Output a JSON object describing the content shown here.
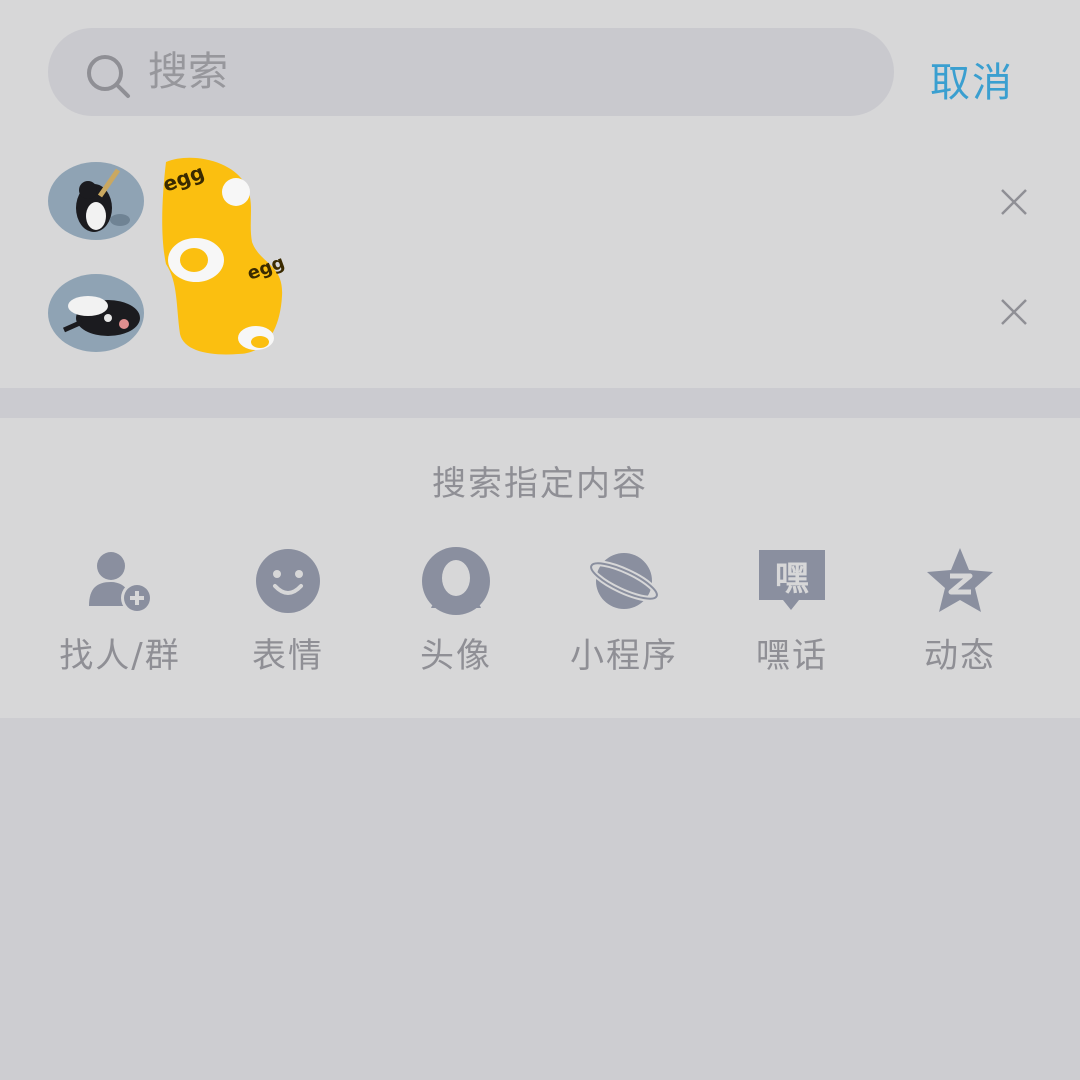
{
  "search": {
    "placeholder": "搜索",
    "cancel_label": "取消"
  },
  "history": [
    {
      "name": "",
      "icon": "penguin-avatar-1"
    },
    {
      "name": "",
      "icon": "penguin-avatar-2"
    }
  ],
  "specified_search": {
    "title": "搜索指定内容",
    "categories": [
      {
        "label": "找人/群",
        "icon": "add-person-icon"
      },
      {
        "label": "表情",
        "icon": "smiley-icon"
      },
      {
        "label": "头像",
        "icon": "avatar-icon"
      },
      {
        "label": "小程序",
        "icon": "planet-icon"
      },
      {
        "label": "嘿话",
        "icon": "speech-bubble-icon"
      },
      {
        "label": "动态",
        "icon": "star-icon"
      }
    ]
  },
  "colors": {
    "accent": "#3a9fd0",
    "icon_gray": "#8a8f9f",
    "text_gray": "#8f8f95"
  }
}
